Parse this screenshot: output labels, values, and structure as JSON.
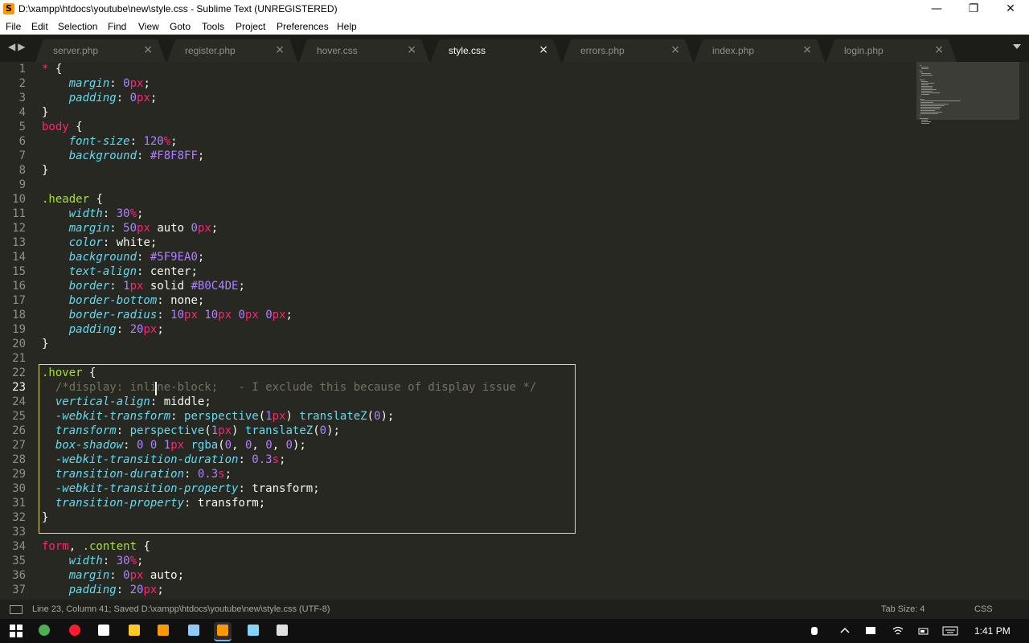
{
  "window": {
    "title": "D:\\xampp\\htdocs\\youtube\\new\\style.css - Sublime Text (UNREGISTERED)",
    "app_icon_letter": "S",
    "minimize": "—",
    "maximize": "❐",
    "close": "✕"
  },
  "menu": [
    "File",
    "Edit",
    "Selection",
    "Find",
    "View",
    "Goto",
    "Tools",
    "Project",
    "Preferences",
    "Help"
  ],
  "tabs": [
    {
      "label": "server.php",
      "active": false
    },
    {
      "label": "register.php",
      "active": false
    },
    {
      "label": "hover.css",
      "active": false
    },
    {
      "label": "style.css",
      "active": true
    },
    {
      "label": "errors.php",
      "active": false
    },
    {
      "label": "index.php",
      "active": false
    },
    {
      "label": "login.php",
      "active": false
    }
  ],
  "tab_close_glyph": "×",
  "nav_arrows": "◀▶",
  "editor": {
    "current_line": 23,
    "lines": [
      "* {",
      "    margin: 0px;",
      "    padding: 0px;",
      "}",
      "body {",
      "    font-size: 120%;",
      "    background: #F8F8FF;",
      "}",
      "",
      ".header {",
      "    width: 30%;",
      "    margin: 50px auto 0px;",
      "    color: white;",
      "    background: #5F9EA0;",
      "    text-align: center;",
      "    border: 1px solid #B0C4DE;",
      "    border-bottom: none;",
      "    border-radius: 10px 10px 0px 0px;",
      "    padding: 20px;",
      "}",
      "",
      ".hover {",
      "  /*display: inline-block;   - I exclude this because of display issue */",
      "  vertical-align: middle;",
      "  -webkit-transform: perspective(1px) translateZ(0);",
      "  transform: perspective(1px) translateZ(0);",
      "  box-shadow: 0 0 1px rgba(0, 0, 0, 0);",
      "  -webkit-transition-duration: 0.3s;",
      "  transition-duration: 0.3s;",
      "  -webkit-transition-property: transform;",
      "  transition-property: transform;",
      "}",
      "",
      "form, .content {",
      "    width: 30%;",
      "    margin: 0px auto;",
      "    padding: 20px;"
    ]
  },
  "theme": {
    "background": "#272822",
    "keyword": "#f92672",
    "selector": "#a6e22e",
    "property": "#66d9ef",
    "number": "#ae81ff",
    "comment": "#75715e",
    "highlight_box": "#e6db74"
  },
  "status": {
    "left": "Line 23, Column 41; Saved D:\\xampp\\htdocs\\youtube\\new\\style.css (UTF-8)",
    "tab_size": "Tab Size: 4",
    "syntax": "CSS"
  },
  "taskbar": {
    "apps": [
      {
        "name": "chrome-icon",
        "color": "#4caf50"
      },
      {
        "name": "opera-icon",
        "color": "#ff1b2d"
      },
      {
        "name": "volume-icon",
        "color": "#ffffff"
      },
      {
        "name": "file-explorer-icon",
        "color": "#ffca28"
      },
      {
        "name": "media-player-icon",
        "color": "#ff9800"
      },
      {
        "name": "notepad-icon",
        "color": "#90caf9"
      },
      {
        "name": "sublime-text-icon",
        "color": "#ff9800"
      },
      {
        "name": "keyboard-icon",
        "color": "#81d4fa"
      },
      {
        "name": "paint-icon",
        "color": "#e0e0e0"
      }
    ],
    "clock": "1:41 PM"
  }
}
